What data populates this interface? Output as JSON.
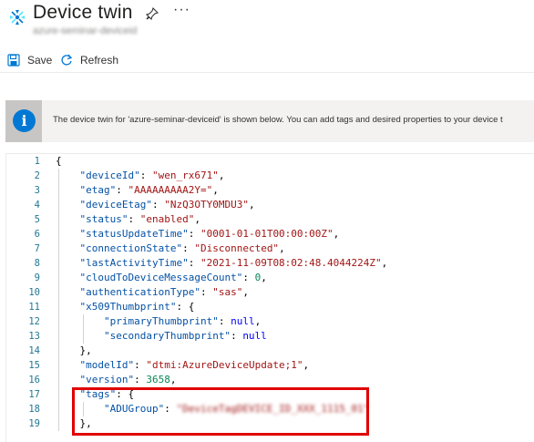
{
  "header": {
    "title": "Device twin",
    "subtitle": "azure-seminar-deviceid"
  },
  "toolbar": {
    "save_label": "Save",
    "refresh_label": "Refresh"
  },
  "info": {
    "message": "The device twin for 'azure-seminar-deviceid' is shown below. You can add tags and desired properties to your device t"
  },
  "editor": {
    "line_numbers": [
      "1",
      "2",
      "3",
      "4",
      "5",
      "6",
      "7",
      "8",
      "9",
      "10",
      "11",
      "12",
      "13",
      "14",
      "15",
      "16",
      "17",
      "18",
      "19"
    ],
    "values": {
      "deviceId": "\"wen_rx671\"",
      "etag": "\"AAAAAAAAA2Y=\"",
      "deviceEtag": "\"NzQ3OTY0MDU3\"",
      "status": "\"enabled\"",
      "statusUpdateTime": "\"0001-01-01T00:00:00Z\"",
      "connectionState": "\"Disconnected\"",
      "lastActivityTime": "\"2021-11-09T08:02:48.4044224Z\"",
      "cloudToDeviceMessageCount": "0",
      "authenticationType": "\"sas\"",
      "primaryThumbprint": "null",
      "secondaryThumbprint": "null",
      "modelId": "\"dtmi:AzureDeviceUpdate;1\"",
      "version": "3658",
      "ADUGroup": "\"DeviceTagDEVICE_ID_XXX_1115_01\""
    }
  }
}
